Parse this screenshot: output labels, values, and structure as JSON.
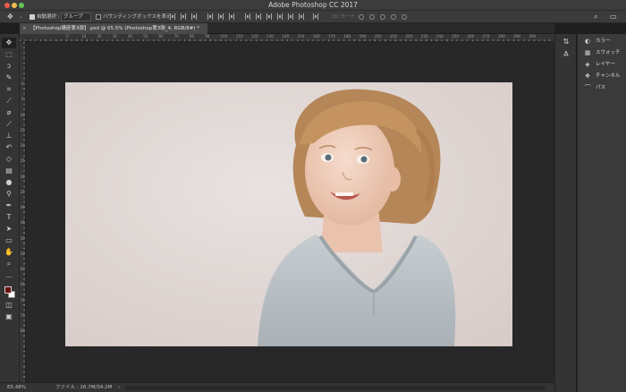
{
  "window": {
    "title": "Adobe Photoshop CC 2017"
  },
  "options_bar": {
    "auto_select_label": "自動選択 :",
    "auto_select_value": "グループ",
    "bounding_box_label": "バウンディングボックスを表示",
    "mode_3d_label": "3D モード :",
    "align_icons": [
      "align-top-icon",
      "align-vcenter-icon",
      "align-bottom-icon",
      "align-left-icon",
      "align-hcenter-icon",
      "align-right-icon",
      "distribute-top-icon",
      "distribute-vcenter-icon",
      "distribute-bottom-icon",
      "distribute-left-icon",
      "distribute-hcenter-icon",
      "distribute-right-icon",
      "auto-align-icon"
    ]
  },
  "document_tab": {
    "close": "×",
    "title": "【Photoshop講座第3弾】.psd @ 65.5% (Photoshop第3弾_4, RGB/8#) *"
  },
  "rulers": {
    "top_labels": [
      "0",
      "10",
      "20",
      "30",
      "40",
      "50",
      "60",
      "70",
      "80",
      "90",
      "100",
      "110",
      "120",
      "130",
      "140",
      "150",
      "160",
      "170",
      "180",
      "190",
      "200",
      "210",
      "220",
      "230",
      "240",
      "250",
      "260",
      "270",
      "280",
      "290",
      "300"
    ],
    "left_labels": [
      "0",
      "5",
      "10",
      "15",
      "20",
      "25",
      "30",
      "35",
      "40",
      "45",
      "50",
      "55",
      "60",
      "65",
      "70",
      "75",
      "80"
    ]
  },
  "tools": [
    "move-tool",
    "marquee-tool",
    "lasso-tool",
    "quick-select-tool",
    "crop-tool",
    "eyedropper-tool",
    "spot-heal-tool",
    "brush-tool",
    "clone-stamp-tool",
    "history-brush-tool",
    "eraser-tool",
    "gradient-tool",
    "blur-tool",
    "dodge-tool",
    "pen-tool",
    "type-tool",
    "path-select-tool",
    "rectangle-tool",
    "hand-tool",
    "zoom-tool",
    "more-tools",
    "quick-mask",
    "screen-mode"
  ],
  "swatches": {
    "foreground": "#6b0f0f",
    "background": "#ffffff"
  },
  "status_bar": {
    "zoom": "65.48%",
    "file_info": "ファイル : 16.7M/34.2M",
    "arrow": "›"
  },
  "panels": [
    {
      "icon": "color-icon",
      "label": "カラー"
    },
    {
      "icon": "swatches-icon",
      "label": "スウォッチ"
    },
    {
      "icon": "layers-icon",
      "label": "レイヤー"
    },
    {
      "icon": "channels-icon",
      "label": "チャンネル"
    },
    {
      "icon": "paths-icon",
      "label": "パス"
    }
  ],
  "toolbar_right": {
    "search": "⌕",
    "workspace": "▭"
  }
}
